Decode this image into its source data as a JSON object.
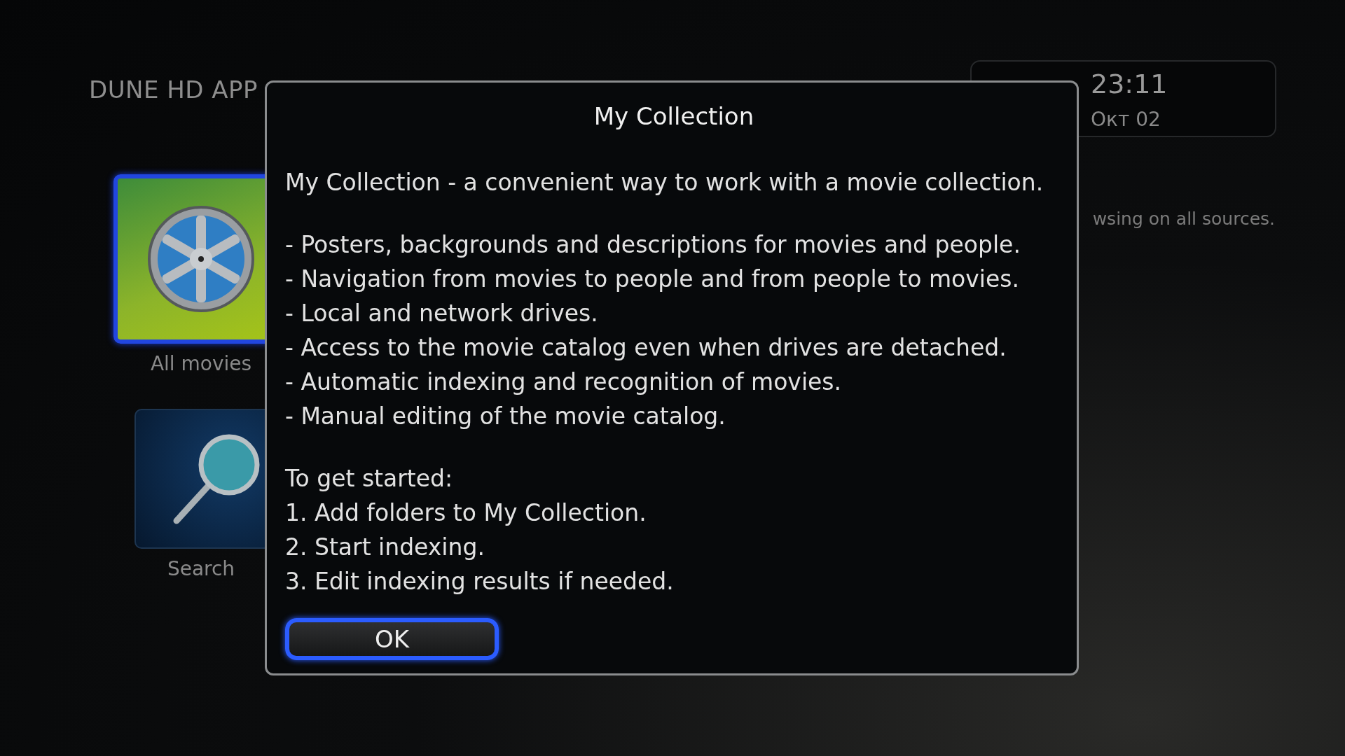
{
  "background": {
    "title": "DUNE HD APP",
    "tiles": [
      {
        "label": "All movies",
        "kind": "reel",
        "selected": true
      },
      {
        "label": "Search",
        "kind": "search",
        "selected": false
      }
    ],
    "clock": {
      "time": "23:11",
      "date": "Окт 02"
    },
    "hint": "wsing on all sources."
  },
  "dialog": {
    "title": "My Collection",
    "paragraphs": [
      [
        "My Collection - a convenient way to work with a movie collection."
      ],
      [
        "- Posters, backgrounds and descriptions for movies and people.",
        "- Navigation from movies to people and from people to movies.",
        "- Local and network drives.",
        "- Access to the movie catalog even when drives are detached.",
        "- Automatic indexing and recognition of movies.",
        "- Manual editing of the movie catalog."
      ],
      [
        "To get started:",
        "1. Add folders to My Collection.",
        "2. Start indexing.",
        "3. Edit indexing results if needed."
      ]
    ],
    "button": {
      "label": "OK",
      "selected": true
    }
  }
}
